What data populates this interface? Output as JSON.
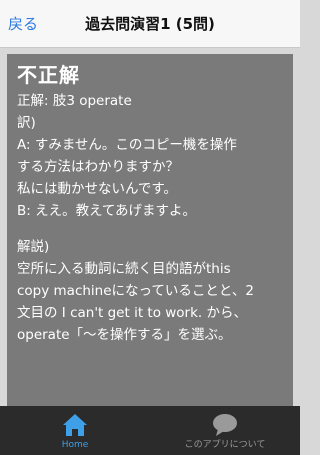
{
  "navbar": {
    "back_label": "戻る",
    "title": "過去問演習1 (5問)"
  },
  "result": {
    "verdict": "不正解",
    "answer": "正解: 肢3 operate",
    "translation_heading": "訳)",
    "translation_lines": [
      "A: すみません。このコピー機を操作",
      "する方法はわかりますか？",
      "私には動かせないんです。",
      "B: ええ。教えてあげますよ。"
    ],
    "explanation_heading": "解説)",
    "explanation_lines": [
      "空所に入る動詞に続く目的語がthis",
      "copy machineになっていることと、2",
      "文目の I can't get it to work. から、",
      "operate「～を操作する」を選ぶ。"
    ]
  },
  "tabbar": {
    "home_label": "Home",
    "about_label": "このアプリについて",
    "home_icon": "house-icon",
    "about_icon": "speech-bubble-icon",
    "active_color": "#3ea0e8"
  }
}
